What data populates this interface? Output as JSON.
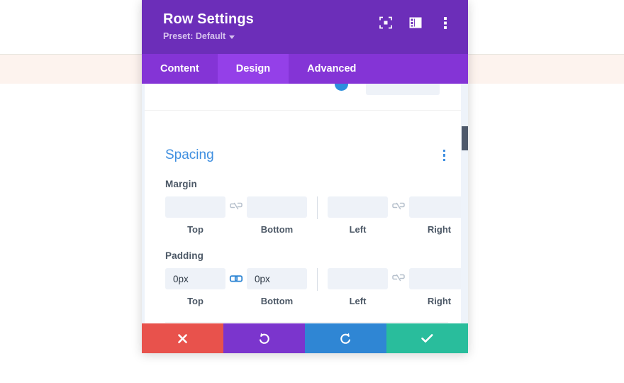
{
  "backdrop": {
    "band_color": "#fdf3ee",
    "page_color": "#ffffff"
  },
  "modal": {
    "header": {
      "title": "Row Settings",
      "preset_label": "Preset: Default",
      "preset_caret": "caret-down-icon",
      "background": "#6c2eb9",
      "icons": [
        {
          "name": "focus-frame-icon",
          "title": "Focus"
        },
        {
          "name": "layout-panel-icon",
          "title": "Layout"
        },
        {
          "name": "kebab-menu-icon",
          "title": "More options"
        }
      ]
    },
    "tabs": [
      {
        "label": "Content",
        "active": false
      },
      {
        "label": "Design",
        "active": true
      },
      {
        "label": "Advanced",
        "active": false
      }
    ],
    "tab_bar_color": "#8434d6",
    "tab_active_color": "#9440e8",
    "body": {
      "sections": [
        {
          "title": "Spacing",
          "title_color": "#3f8fe0",
          "kebab": "kebab-menu-icon",
          "groups": [
            {
              "label": "Margin",
              "fields": [
                {
                  "label": "Top",
                  "value": "",
                  "placeholder": ""
                },
                {
                  "label": "Bottom",
                  "value": "",
                  "placeholder": ""
                },
                {
                  "label": "Left",
                  "value": "",
                  "placeholder": ""
                },
                {
                  "label": "Right",
                  "value": "",
                  "placeholder": ""
                }
              ],
              "links": [
                {
                  "name": "link-broken-icon",
                  "linked": false,
                  "color": "#b7c1cd"
                },
                {
                  "name": "link-broken-icon",
                  "linked": false,
                  "color": "#b7c1cd"
                }
              ]
            },
            {
              "label": "Padding",
              "fields": [
                {
                  "label": "Top",
                  "value": "0px",
                  "placeholder": ""
                },
                {
                  "label": "Bottom",
                  "value": "0px",
                  "placeholder": ""
                },
                {
                  "label": "Left",
                  "value": "",
                  "placeholder": ""
                },
                {
                  "label": "Right",
                  "value": "",
                  "placeholder": ""
                }
              ],
              "links": [
                {
                  "name": "link-connected-icon",
                  "linked": true,
                  "color": "#2f86d4"
                },
                {
                  "name": "link-broken-icon",
                  "linked": false,
                  "color": "#b7c1cd"
                }
              ]
            }
          ]
        }
      ],
      "scrollbar": {
        "track_color": "#eef3fa",
        "thumb_color": "#4e596b"
      }
    },
    "footer": {
      "buttons": [
        {
          "name": "cancel-button",
          "icon": "close-x-icon",
          "color": "#e8524c"
        },
        {
          "name": "undo-button",
          "icon": "undo-icon",
          "color": "#7b35cd"
        },
        {
          "name": "redo-button",
          "icon": "redo-icon",
          "color": "#2f86d4"
        },
        {
          "name": "save-button",
          "icon": "checkmark-icon",
          "color": "#29bd9c"
        }
      ]
    }
  }
}
